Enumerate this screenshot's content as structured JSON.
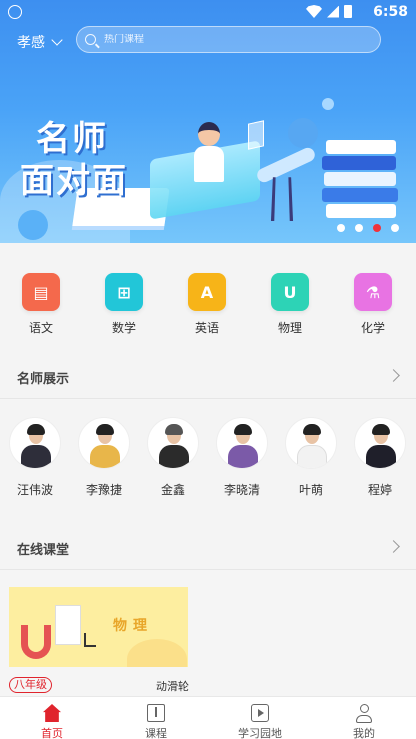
{
  "status_bar": {
    "time": "6:58"
  },
  "header": {
    "city": "孝感",
    "search_placeholder": "热门课程"
  },
  "banner": {
    "title_line1": "名师",
    "title_line2": "面对面",
    "slides_total": 4,
    "active_slide": 3
  },
  "categories": [
    {
      "label": "语文",
      "icon": "book-icon",
      "color": "#f4694c"
    },
    {
      "label": "数学",
      "icon": "calculator-icon",
      "color": "#22c6d8"
    },
    {
      "label": "英语",
      "icon": "letter-a-icon",
      "color": "#f7b418"
    },
    {
      "label": "物理",
      "icon": "magnet-icon",
      "color": "#2dd3b6"
    },
    {
      "label": "化学",
      "icon": "test-tube-icon",
      "color": "#e873e3"
    }
  ],
  "teachers_section": {
    "title": "名师展示"
  },
  "teachers": [
    {
      "name": "汪伟波",
      "outfit": "#2e2e3a"
    },
    {
      "name": "李豫捷",
      "outfit": "#e8b64a"
    },
    {
      "name": "金鑫",
      "outfit": "#2b2b2b"
    },
    {
      "name": "李晓清",
      "outfit": "#7b5aa8"
    },
    {
      "name": "叶萌",
      "outfit": "#f2f2f2"
    },
    {
      "name": "程婷",
      "outfit": "#1f1f2a"
    }
  ],
  "online_section": {
    "title": "在线课堂"
  },
  "course": {
    "subject": "物理",
    "grade": "八年级",
    "title": "动滑轮"
  },
  "tabs": [
    {
      "label": "首页",
      "icon": "home-icon",
      "active": true
    },
    {
      "label": "课程",
      "icon": "book-open-icon",
      "active": false
    },
    {
      "label": "学习园地",
      "icon": "play-icon",
      "active": false
    },
    {
      "label": "我的",
      "icon": "user-icon",
      "active": false
    }
  ]
}
